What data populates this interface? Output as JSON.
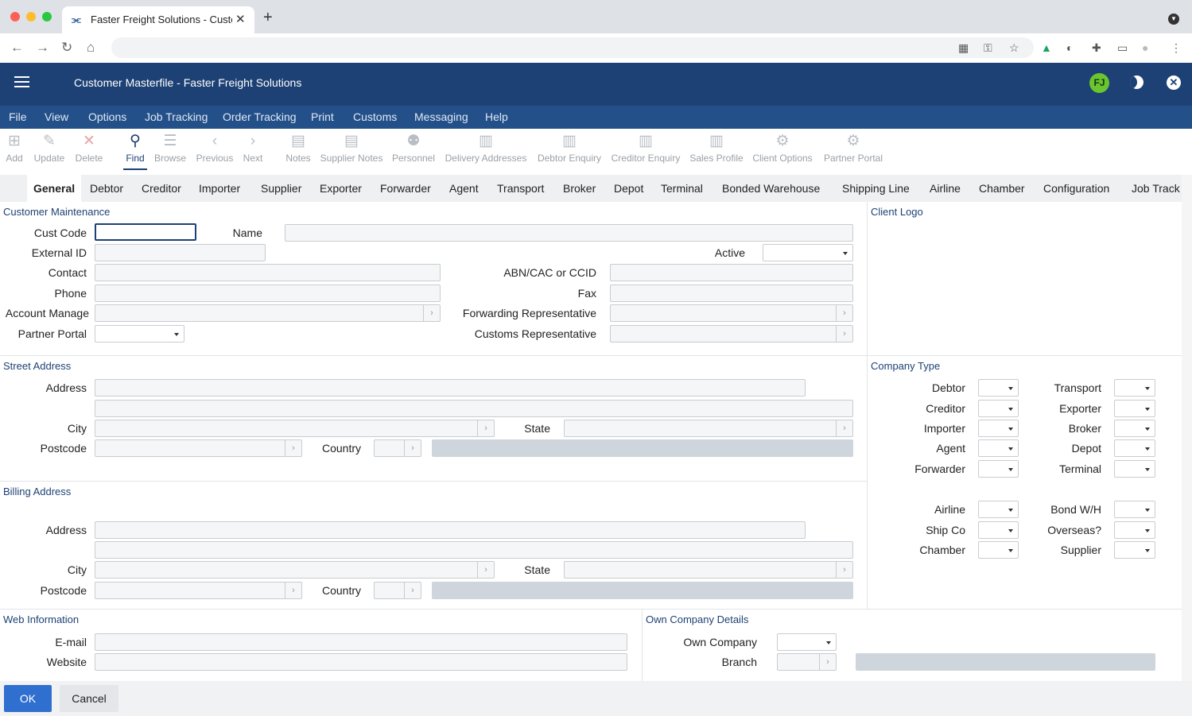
{
  "browser": {
    "tab_title": "Faster Freight Solutions - Customer Masterfile",
    "favicon": "⫘",
    "new_tab": "+",
    "close_tab": "✕"
  },
  "app": {
    "title": "Customer Masterfile - Faster Freight Solutions",
    "avatar": "FJ",
    "colors": {
      "header": "#1d4174",
      "menu": "#24508a",
      "accent": "#2f6fcf",
      "avatar": "#6ac52e"
    }
  },
  "menu": [
    "File",
    "View",
    "Options",
    "Job Tracking",
    "Order Tracking",
    "Print",
    "Customs",
    "Messaging",
    "Help"
  ],
  "toolbar": [
    {
      "label": "Add",
      "icon": "add-icon"
    },
    {
      "label": "Update",
      "icon": "pencil-icon"
    },
    {
      "label": "Delete",
      "icon": "x-icon"
    },
    {
      "label": "Find",
      "icon": "search-icon"
    },
    {
      "label": "Browse",
      "icon": "list-icon"
    },
    {
      "label": "Previous",
      "icon": "chevron-left-icon"
    },
    {
      "label": "Next",
      "icon": "chevron-right-icon"
    },
    {
      "label": "Notes",
      "icon": "clipboard-icon"
    },
    {
      "label": "Supplier Notes",
      "icon": "clipboard-icon"
    },
    {
      "label": "Personnel",
      "icon": "people-icon"
    },
    {
      "label": "Delivery Addresses",
      "icon": "table-icon"
    },
    {
      "label": "Debtor Enquiry",
      "icon": "table-icon"
    },
    {
      "label": "Creditor Enquiry",
      "icon": "table-icon"
    },
    {
      "label": "Sales Profile",
      "icon": "table-icon"
    },
    {
      "label": "Client Options",
      "icon": "toggle-icon"
    },
    {
      "label": "Partner Portal",
      "icon": "gear-icon"
    }
  ],
  "tabs": [
    "General",
    "Debtor",
    "Creditor",
    "Importer",
    "Supplier",
    "Exporter",
    "Forwarder",
    "Agent",
    "Transport",
    "Broker",
    "Depot",
    "Terminal",
    "Bonded Warehouse",
    "Shipping Line",
    "Airline",
    "Chamber",
    "Configuration",
    "Job Track"
  ],
  "customer": {
    "section": "Customer Maintenance",
    "cust_code": "Cust Code",
    "name": "Name",
    "external_id": "External ID",
    "active": "Active",
    "contact": "Contact",
    "abn": "ABN/CAC or CCID",
    "phone": "Phone",
    "fax": "Fax",
    "account_manager": "Account Manage",
    "forwarding_rep": "Forwarding Representative",
    "partner_portal": "Partner Portal",
    "customs_rep": "Customs Representative"
  },
  "client_logo": "Client Logo",
  "street": {
    "section": "Street Address",
    "address": "Address",
    "city": "City",
    "state": "State",
    "postcode": "Postcode",
    "country": "Country"
  },
  "billing": {
    "section": "Billing Address",
    "address": "Address",
    "city": "City",
    "state": "State",
    "postcode": "Postcode",
    "country": "Country"
  },
  "company_type": {
    "section": "Company Type",
    "left": [
      "Debtor",
      "Creditor",
      "Importer",
      "Agent",
      "Forwarder",
      "Airline",
      "Ship Co",
      "Chamber"
    ],
    "right": [
      "Transport",
      "Exporter",
      "Broker",
      "Depot",
      "Terminal",
      "Bond W/H",
      "Overseas?",
      "Supplier"
    ]
  },
  "web": {
    "section": "Web Information",
    "email": "E-mail",
    "website": "Website"
  },
  "own": {
    "section": "Own Company Details",
    "own_company": "Own Company",
    "branch": "Branch"
  },
  "buttons": {
    "ok": "OK",
    "cancel": "Cancel"
  }
}
